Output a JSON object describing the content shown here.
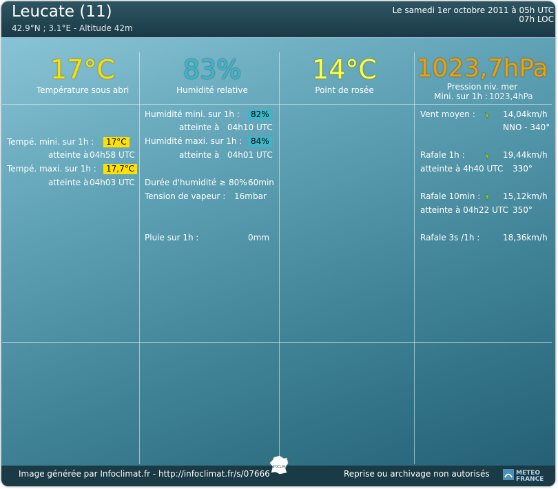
{
  "header": {
    "title": "Leucate (11)",
    "coords": "42.9°N ; 3.1°E - Altitude 42m",
    "date_utc": "Le samedi 1er octobre 2011 à 05h UTC",
    "date_loc": "07h LOC"
  },
  "main": {
    "temp": {
      "value": "17°C",
      "label": "Température sous abri"
    },
    "humidity": {
      "value": "83%",
      "label": "Humidité relative"
    },
    "dewpoint": {
      "value": "14°C",
      "label": "Point de rosée"
    },
    "pressure": {
      "value": "1023,7hPa",
      "label": "Pression niv. mer",
      "min_label": "Mini. sur 1h :",
      "min_value": "1023,4hPa"
    }
  },
  "temp_details": {
    "min_label": "Tempé. mini. sur 1h :",
    "min_value": "17°C",
    "min_reached": "atteinte à",
    "min_time": "04h58 UTC",
    "max_label": "Tempé. maxi. sur 1h :",
    "max_value": "17,7°C",
    "max_reached": "atteinte à",
    "max_time": "04h03 UTC"
  },
  "humidity_details": {
    "min_label": "Humidité mini. sur 1h :",
    "min_value": "82%",
    "min_reached": "atteinte à",
    "min_time": "04h10 UTC",
    "max_label": "Humidité maxi. sur 1h :",
    "max_value": "84%",
    "max_reached": "atteinte à",
    "max_time": "04h01 UTC",
    "duration_label": "Durée d'humidité ≥ 80% :",
    "duration_value": "60min",
    "vapor_label": "Tension de vapeur :",
    "vapor_value": "16mbar",
    "rain_label": "Pluie sur 1h :",
    "rain_value": "0mm"
  },
  "wind_details": {
    "mean_label": "Vent moyen :",
    "mean_value": "14,04km/h",
    "mean_dir": "NNO - 340°",
    "gust1h_label": "Rafale 1h :",
    "gust1h_value": "19,44km/h",
    "gust1h_time": "atteinte à 4h40 UTC",
    "gust1h_dir": "330°",
    "gust10_label": "Rafale 10min :",
    "gust10_value": "15,12km/h",
    "gust10_time": "atteinte à 04h22 UTC",
    "gust10_dir": "350°",
    "gust3s_label": "Rafale 3s /1h :",
    "gust3s_value": "18,36km/h"
  },
  "footer": {
    "left": "Image générée par Infoclimat.fr - http://infoclimat.fr/s/07666",
    "right": "Reprise ou archivage non autorisés",
    "logo_ic": "INFOCLIMAT",
    "logo_mf_1": "METEO",
    "logo_mf_2": "FRANCE"
  },
  "colors": {
    "temp": "#ffe000",
    "humidity": "#3fb6c8",
    "pressure": "#f0a000",
    "dewpoint": "#ffff40"
  },
  "icons": [
    "wind-arrow-icon",
    "france-map-icon",
    "meteo-france-logo-icon"
  ]
}
